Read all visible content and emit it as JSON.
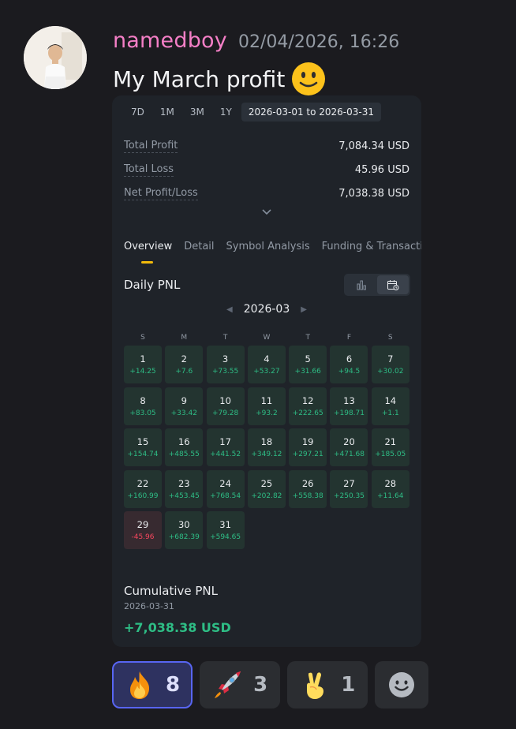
{
  "message": {
    "author": "namedboy",
    "timestamp": "02/04/2026, 16:26",
    "text": "My March profit",
    "inline_emoji_icon": "slightly-smiling-face-icon",
    "author_color": "#f47fc6"
  },
  "card": {
    "ranges": [
      "7D",
      "1M",
      "3M",
      "1Y"
    ],
    "selected_range": "2026-03-01 to 2026-03-31",
    "stats": [
      {
        "label": "Total Profit",
        "value": "7,084.34 USD"
      },
      {
        "label": "Total Loss",
        "value": "45.96 USD"
      },
      {
        "label": "Net Profit/Loss",
        "value": "7,038.38 USD"
      }
    ],
    "tabs": [
      "Overview",
      "Detail",
      "Symbol Analysis",
      "Funding & Transaction"
    ],
    "active_tab": "Overview",
    "daily_title": "Daily PNL",
    "month": "2026-03",
    "weekdays": [
      "S",
      "M",
      "T",
      "W",
      "T",
      "F",
      "S"
    ],
    "days": [
      {
        "day": "1",
        "pnl": "+14.25"
      },
      {
        "day": "2",
        "pnl": "+7.6"
      },
      {
        "day": "3",
        "pnl": "+73.55"
      },
      {
        "day": "4",
        "pnl": "+53.27"
      },
      {
        "day": "5",
        "pnl": "+31.66"
      },
      {
        "day": "6",
        "pnl": "+94.5"
      },
      {
        "day": "7",
        "pnl": "+30.02"
      },
      {
        "day": "8",
        "pnl": "+83.05"
      },
      {
        "day": "9",
        "pnl": "+33.42"
      },
      {
        "day": "10",
        "pnl": "+79.28"
      },
      {
        "day": "11",
        "pnl": "+93.2"
      },
      {
        "day": "12",
        "pnl": "+222.65"
      },
      {
        "day": "13",
        "pnl": "+198.71"
      },
      {
        "day": "14",
        "pnl": "+1.1"
      },
      {
        "day": "15",
        "pnl": "+154.74"
      },
      {
        "day": "16",
        "pnl": "+485.55"
      },
      {
        "day": "17",
        "pnl": "+441.52"
      },
      {
        "day": "18",
        "pnl": "+349.12"
      },
      {
        "day": "19",
        "pnl": "+297.21"
      },
      {
        "day": "20",
        "pnl": "+471.68"
      },
      {
        "day": "21",
        "pnl": "+185.05"
      },
      {
        "day": "22",
        "pnl": "+160.99"
      },
      {
        "day": "23",
        "pnl": "+453.45"
      },
      {
        "day": "24",
        "pnl": "+768.54"
      },
      {
        "day": "25",
        "pnl": "+202.82"
      },
      {
        "day": "26",
        "pnl": "+558.38"
      },
      {
        "day": "27",
        "pnl": "+250.35"
      },
      {
        "day": "28",
        "pnl": "+11.64"
      },
      {
        "day": "29",
        "pnl": "-45.96"
      },
      {
        "day": "30",
        "pnl": "+682.39"
      },
      {
        "day": "31",
        "pnl": "+594.65"
      }
    ],
    "cumulative_title": "Cumulative PNL",
    "cumulative_date": "2026-03-31",
    "cumulative_value": "+7,038.38 USD",
    "colors": {
      "positive": "#2ebd85",
      "negative": "#f6465d",
      "accent": "#f0b90b"
    }
  },
  "reactions": [
    {
      "emoji_icon": "fire-icon",
      "count": "8",
      "mine": true
    },
    {
      "emoji_icon": "rocket-icon",
      "count": "3",
      "mine": false
    },
    {
      "emoji_icon": "victory-hand-icon",
      "count": "1",
      "mine": false
    }
  ],
  "add_reaction_icon": "add-reaction-icon"
}
